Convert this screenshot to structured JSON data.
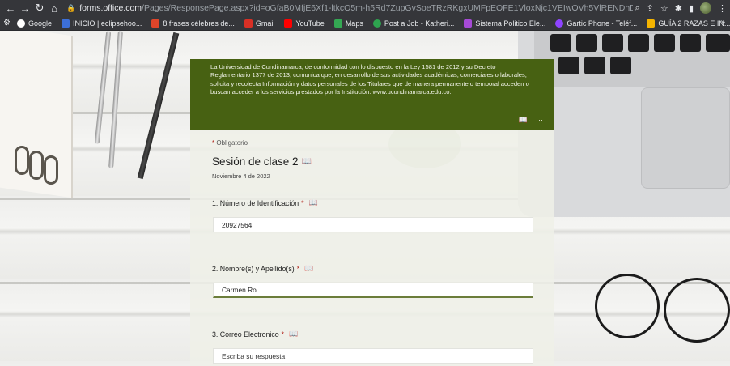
{
  "browser": {
    "url_domain": "forms.office.com",
    "url_path": "/Pages/ResponsePage.aspx?id=oGfaB0MfjE6Xf1-ltkcO5m-h5Rd7ZupGvSoeTRzRKgxUMFpEOFE1VloxNjc1VEIwOVh5VlRENDhDUS4u",
    "bookmarks": [
      {
        "label": "Google",
        "color": "#ffffff"
      },
      {
        "label": "INICIO | eclipsehoo...",
        "color": "#3c6fd8"
      },
      {
        "label": "8 frases célebres de...",
        "color": "#e0452a"
      },
      {
        "label": "Gmail",
        "color": "#d93025"
      },
      {
        "label": "YouTube",
        "color": "#ff0000"
      },
      {
        "label": "Maps",
        "color": "#34a853"
      },
      {
        "label": "Post a Job - Katheri...",
        "color": "#2ea44f"
      },
      {
        "label": "Sistema Politico Ele...",
        "color": "#a64ad6"
      },
      {
        "label": "Gartic Phone - Teléf...",
        "color": "#8e44ff"
      },
      {
        "label": "GUÍA 2 RAZAS E IN...",
        "color": "#f4b400"
      }
    ],
    "more": "»"
  },
  "form": {
    "banner_text": "La Universidad de Cundinamarca, de conformidad con lo dispuesto en la Ley 1581 de 2012 y su Decreto Reglamentario 1377 de 2013, comunica que, en desarrollo de sus actividades académicas, comerciales o laborales, solicita y recolecta Información y datos personales de los Titulares que de manera permanente o temporal acceden o buscan acceder a los servicios prestados por la Institución. www.ucundinamarca.edu.co.",
    "banner_color": "#476112",
    "required_note": "Obligatorio",
    "title": "Sesión de clase 2",
    "subtitle": "Noviembre 4 de 2022",
    "questions": [
      {
        "label": "1. Número de Identificación",
        "value": "20927564",
        "placeholder": ""
      },
      {
        "label": "2. Nombre(s) y Apellido(s)",
        "value": "Carmen Ro",
        "placeholder": ""
      },
      {
        "label": "3. Correo Electronico",
        "value": "",
        "placeholder": "Escriba su respuesta"
      }
    ]
  }
}
